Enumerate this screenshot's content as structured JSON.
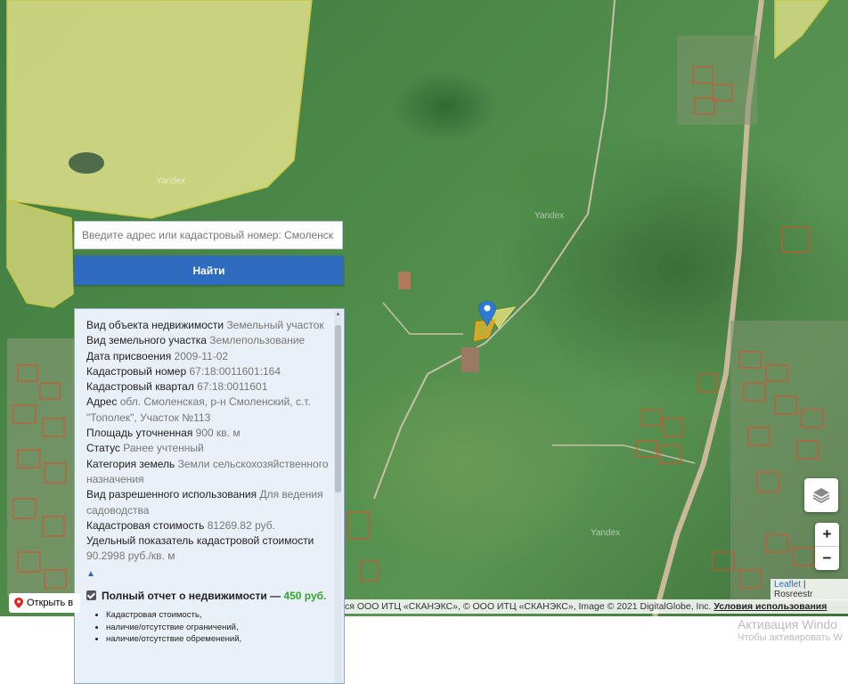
{
  "search": {
    "placeholder": "Введите адрес или кадастровый номер: Смоленск",
    "button_label": "Найти"
  },
  "info": {
    "rows": [
      {
        "label": "Вид объекта недвижимости",
        "value": "Земельный участок"
      },
      {
        "label": "Вид земельного участка",
        "value": "Землепользование"
      },
      {
        "label": "Дата присвоения",
        "value": "2009-11-02"
      },
      {
        "label": "Кадастровый номер",
        "value": "67:18:0011601:164"
      },
      {
        "label": "Кадастровый квартал",
        "value": "67:18:0011601"
      },
      {
        "label": "Адрес",
        "value": "обл. Смоленская, р-н Смоленский, с.т. \"Тополек\", Участок №113"
      },
      {
        "label": "Площадь уточненная",
        "value": "900 кв. м"
      },
      {
        "label": "Статус",
        "value": "Ранее учтенный"
      },
      {
        "label": "Категория земель",
        "value": "Земли сельскохозяйственного назначения"
      },
      {
        "label": "Вид разрешенного использования",
        "value": "Для ведения садоводства"
      },
      {
        "label": "Кадастровая стоимость",
        "value": "81269.82 руб."
      },
      {
        "label": "Удельный показатель кадастровой стоимости",
        "value": "90.2998 руб./кв. м"
      }
    ],
    "collapse_glyph": "▲"
  },
  "report": {
    "title": "Полный отчет о недвижимости —",
    "price": "450 руб.",
    "bullets": [
      "Кадастровая стоимость,",
      "наличие/отсутствие ограничений,",
      "наличие/отсутствие обременений,"
    ]
  },
  "map": {
    "watermarks": [
      "Yandex",
      "Yandex",
      "Yandex"
    ],
    "open_label": "Открыть в",
    "attribution": "ся ООО ИТЦ «СКАНЭКС», © ООО ИТЦ «СКАНЭКС», Image © 2021 DigitalGlobe, Inc.",
    "terms_label": "Условия использования",
    "leaflet_label": "Leaflet",
    "leaflet_separator": "|",
    "rosreestr_label": "Rosreestr",
    "zoom_in": "+",
    "zoom_out": "−"
  },
  "os": {
    "activation_title": "Активация Windo",
    "activation_sub": "Чтобы активировать W"
  },
  "colors": {
    "accent": "#2f6bbf",
    "price_green": "#2fa82f",
    "plot_outline": "#e04a2a",
    "parcel_fill": "#e8e07a",
    "marker": "#2f7ad6"
  }
}
